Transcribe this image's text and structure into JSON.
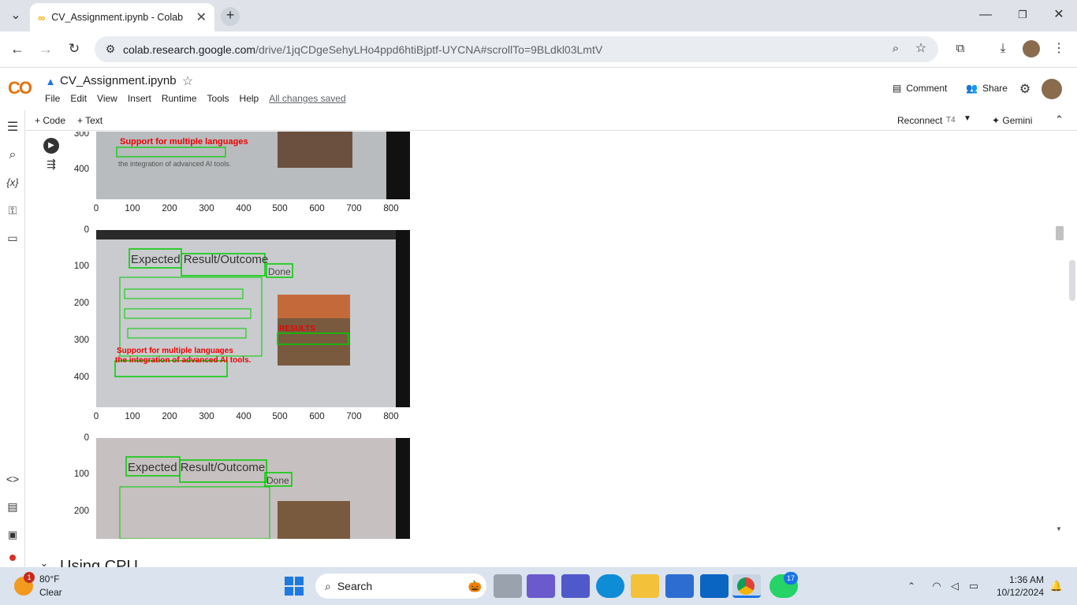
{
  "browser": {
    "tab_title": "CV_Assignment.ipynb - Colab",
    "url_host": "colab.research.google.com",
    "url_path": "/drive/1jqCDgeSehyLHo4ppd6htiBjptf-UYCNA#scrollTo=9BLdkl03LmtV"
  },
  "colab": {
    "logo": "CO",
    "notebook_name": "CV_Assignment.ipynb",
    "menu": [
      "File",
      "Edit",
      "View",
      "Insert",
      "Runtime",
      "Tools",
      "Help"
    ],
    "saved_status": "All changes saved",
    "comment_label": "Comment",
    "share_label": "Share",
    "add_code": "+ Code",
    "add_text": "+ Text",
    "reconnect_label": "Reconnect",
    "runtime_type": "T4",
    "gemini_label": "Gemini",
    "next_section": "Using CPU"
  },
  "plots": {
    "x_ticks": [
      "0",
      "100",
      "200",
      "300",
      "400",
      "500",
      "600",
      "700",
      "800"
    ],
    "plot1_y_ticks": [
      "300",
      "400"
    ],
    "plot2_y_ticks": [
      "0",
      "100",
      "200",
      "300",
      "400"
    ],
    "plot3_y_ticks": [
      "0",
      "100",
      "200"
    ]
  },
  "slide_text": {
    "header": "Expected Result/Outcome",
    "done": "Done",
    "results": "RESULTS",
    "support": "Support for multiple languages",
    "integration": "the integration of advanced AI tools."
  },
  "taskbar": {
    "weather_temp": "80°F",
    "weather_desc": "Clear",
    "weather_badge": "1",
    "search_label": "Search",
    "whatsapp_badge": "17",
    "time": "1:36 AM",
    "date": "10/12/2024"
  }
}
